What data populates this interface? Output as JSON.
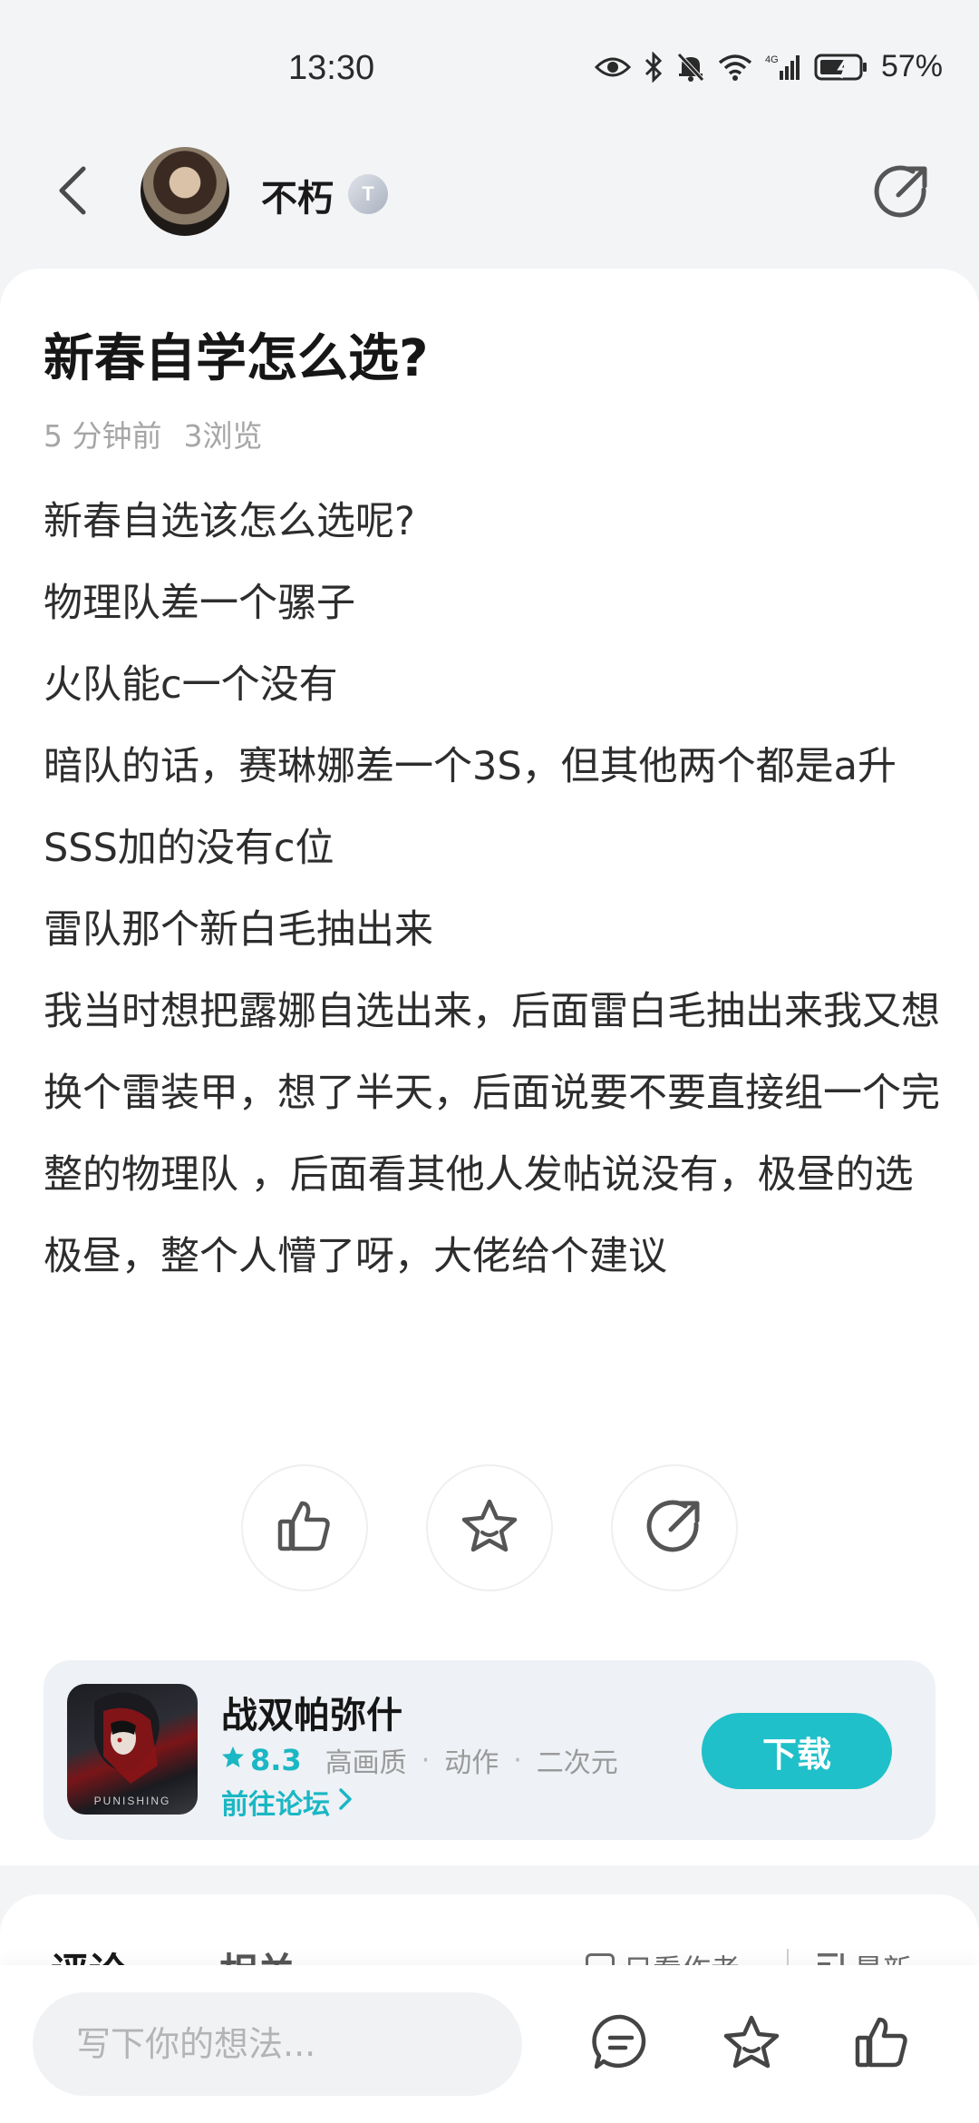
{
  "status_bar": {
    "time": "13:30",
    "battery": "57%"
  },
  "header": {
    "user_name": "不朽",
    "user_badge": "T",
    "icons": [
      "back-icon",
      "share-icon"
    ]
  },
  "post": {
    "title": "新春自学怎么选?",
    "time_ago": "5 分钟前",
    "views": "3浏览",
    "paragraphs": [
      "新春自选该怎么选呢?",
      "物理队差一个骡子",
      "火队能c一个没有",
      "暗队的话，赛琳娜差一个3S，但其他两个都是a升SSS加的没有c位",
      "雷队那个新白毛抽出来",
      "我当时想把露娜自选出来，后面雷白毛抽出来我又想换个雷装甲，想了半天，后面说要不要直接组一个完整的物理队 ，后面看其他人发帖说没有，极昼的选极昼，整个人懵了呀，大佬给个建议"
    ],
    "actions": [
      "like-icon",
      "favorite-icon",
      "share-icon"
    ]
  },
  "game": {
    "name": "战双帕弥什",
    "icon_text": "PUNISHING",
    "rating": "8.3",
    "tags": [
      "高画质",
      "动作",
      "二次元"
    ],
    "forum_link": "前往论坛",
    "download_label": "下载",
    "accent_color": "#1fc0c9"
  },
  "comments": {
    "tab_comments": "评论",
    "tab_related": "相关",
    "author_only": "只看作者",
    "sort_label": "最新"
  },
  "bottom_bar": {
    "input_placeholder": "写下你的想法...",
    "icons": [
      "comment-icon",
      "favorite-icon",
      "like-icon"
    ]
  }
}
